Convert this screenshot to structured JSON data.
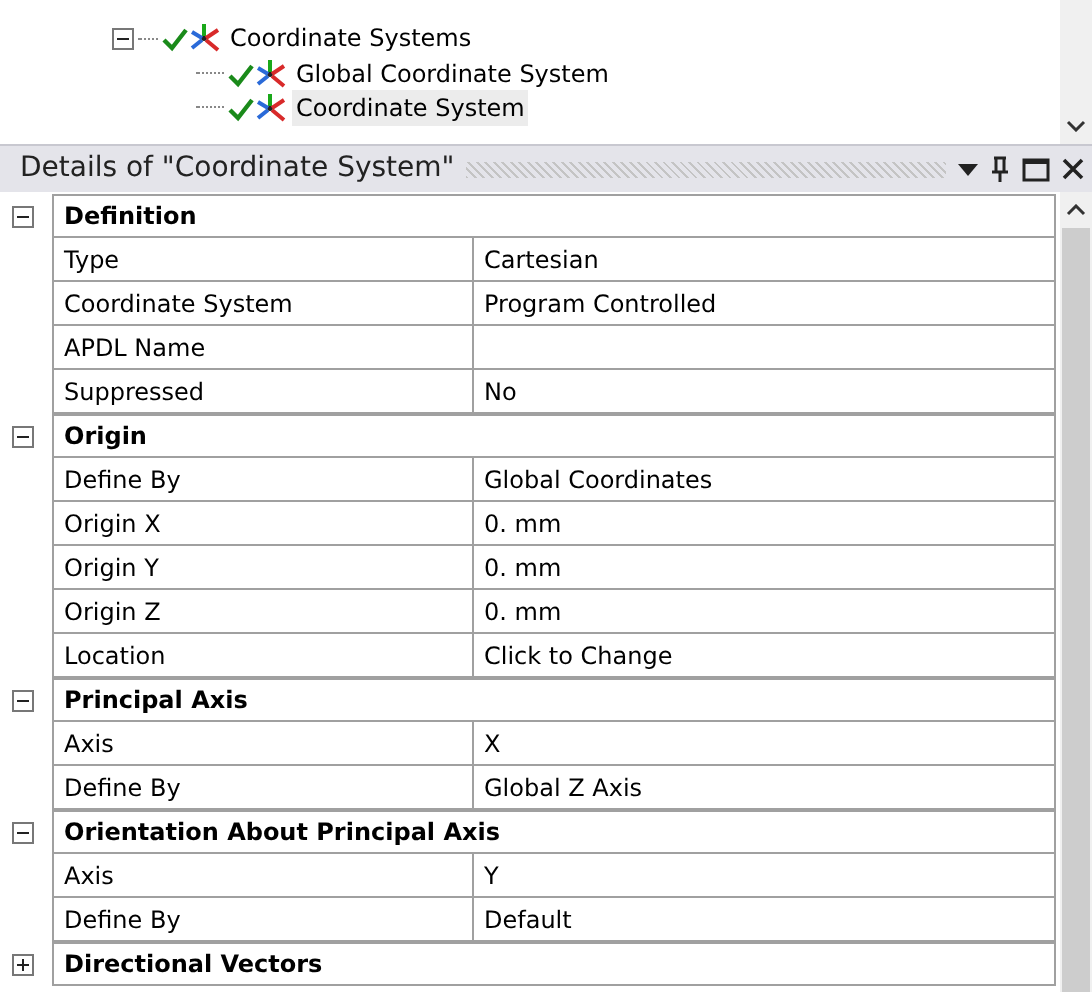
{
  "tree": {
    "label": "Coordinate Systems",
    "expanded": true,
    "children": [
      {
        "label": "Global Coordinate System",
        "selected": false
      },
      {
        "label": "Coordinate System",
        "selected": true
      }
    ]
  },
  "panel": {
    "title": "Details of \"Coordinate System\""
  },
  "sections": [
    {
      "title": "Definition",
      "expanded": true,
      "rows": [
        {
          "name": "Type",
          "value": "Cartesian"
        },
        {
          "name": "Coordinate System",
          "value": "Program Controlled"
        },
        {
          "name": "APDL Name",
          "value": ""
        },
        {
          "name": "Suppressed",
          "value": "No"
        }
      ]
    },
    {
      "title": "Origin",
      "expanded": true,
      "rows": [
        {
          "name": "Define By",
          "value": "Global Coordinates"
        },
        {
          "name": "Origin X",
          "value": "0. mm"
        },
        {
          "name": "Origin Y",
          "value": "0. mm"
        },
        {
          "name": "Origin Z",
          "value": "0. mm"
        },
        {
          "name": "Location",
          "value": "Click to Change"
        }
      ]
    },
    {
      "title": "Principal Axis",
      "expanded": true,
      "rows": [
        {
          "name": "Axis",
          "value": "X"
        },
        {
          "name": "Define By",
          "value": "Global Z Axis"
        }
      ]
    },
    {
      "title": "Orientation About Principal Axis",
      "expanded": true,
      "rows": [
        {
          "name": "Axis",
          "value": "Y"
        },
        {
          "name": "Define By",
          "value": "Default"
        }
      ]
    },
    {
      "title": "Directional Vectors",
      "expanded": false
    }
  ]
}
